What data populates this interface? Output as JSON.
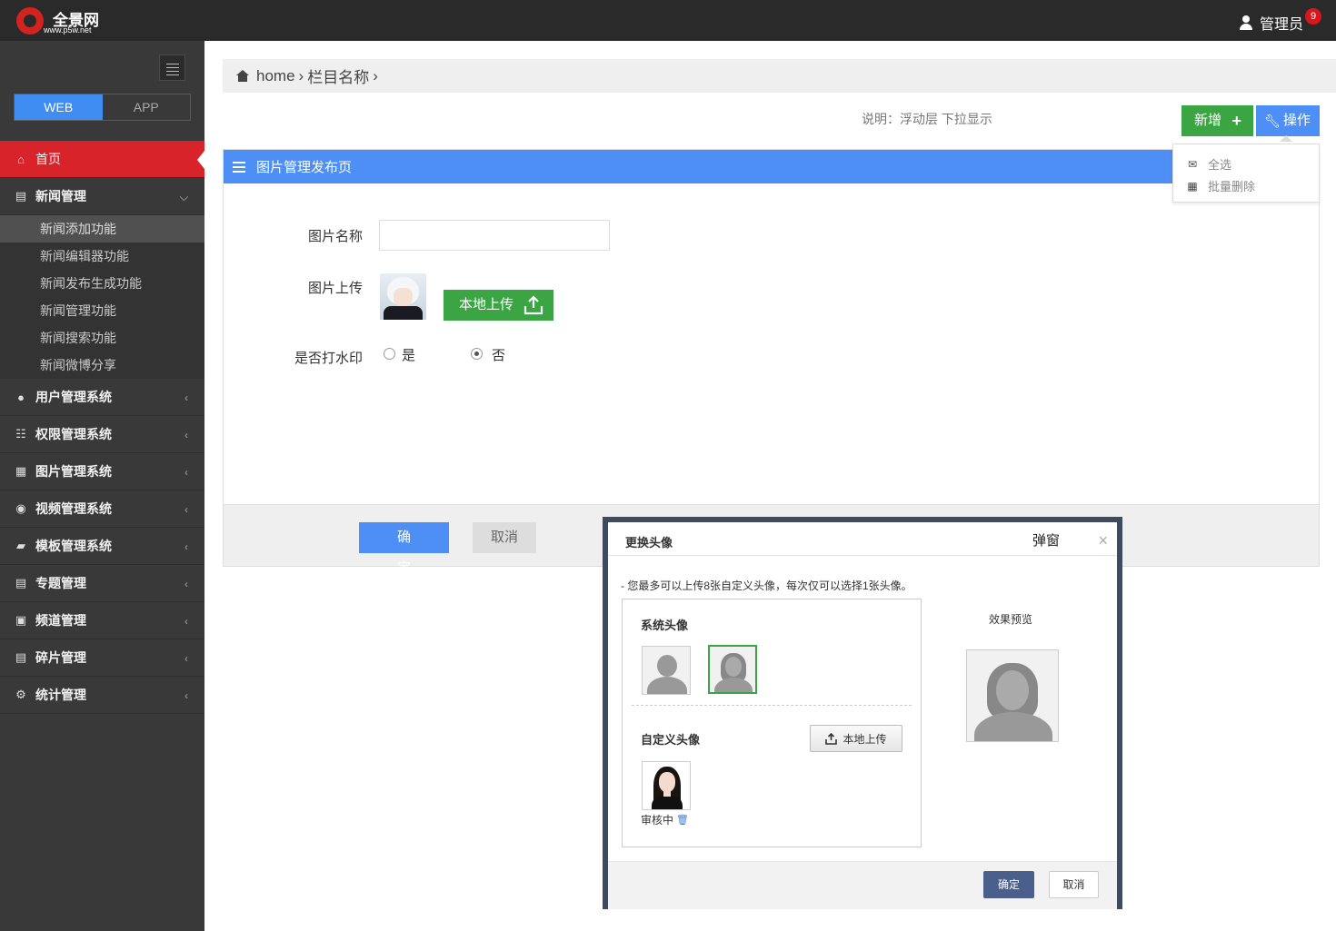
{
  "topbar": {
    "logo_name": "全景网",
    "logo_url": "www.p5w.net",
    "admin_label": "管理员",
    "notification_count": "9"
  },
  "sidebar": {
    "switch": {
      "web": "WEB",
      "app": "APP",
      "active": "WEB"
    },
    "home": "首页",
    "news": {
      "label": "新闻管理",
      "items": [
        "新闻添加功能",
        "新闻编辑器功能",
        "新闻发布生成功能",
        "新闻管理功能",
        "新闻搜索功能",
        "新闻微博分享"
      ],
      "active_item": "新闻添加功能"
    },
    "sections": [
      {
        "label": "用户管理系统",
        "icon": "user-icon"
      },
      {
        "label": "权限管理系统",
        "icon": "sitemap-icon"
      },
      {
        "label": "图片管理系统",
        "icon": "grid-icon"
      },
      {
        "label": "视频管理系统",
        "icon": "map-marker-icon"
      },
      {
        "label": "模板管理系统",
        "icon": "folder-open-icon"
      },
      {
        "label": "专题管理",
        "icon": "file-icon"
      },
      {
        "label": "频道管理",
        "icon": "gift-icon"
      },
      {
        "label": "碎片管理",
        "icon": "file-icon"
      },
      {
        "label": "统计管理",
        "icon": "gears-icon"
      }
    ]
  },
  "breadcrumb": {
    "home": "home",
    "section": "栏目名称"
  },
  "toolbar": {
    "note": "说明：浮动层  下拉显示",
    "add_label": "新增",
    "op_label": "操作",
    "dropdown": [
      "全选",
      "批量删除"
    ]
  },
  "panel": {
    "title": "图片管理发布页",
    "name_label": "图片名称",
    "name_value": "",
    "upload_label": "图片上传",
    "upload_button": "本地上传",
    "watermark_label": "是否打水印",
    "watermark_options": [
      "是",
      "否"
    ],
    "watermark_selected": "否",
    "confirm": "确 定",
    "cancel": "取消"
  },
  "modal": {
    "title": "更换头像",
    "tag": "弹窗",
    "tip": "- 您最多可以上传8张自定义头像，每次仅可以选择1张头像。",
    "system_label": "系统头像",
    "custom_label": "自定义头像",
    "local_upload": "本地上传",
    "review_status": "审核中",
    "preview_label": "效果预览",
    "confirm": "确定",
    "cancel": "取消"
  },
  "colors": {
    "topbar": "#2a2a2a",
    "sidebar": "#393939",
    "active_red": "#d9232a",
    "primary_blue": "#4e8ff5",
    "success_green": "#3aa542",
    "modal_border": "#3d4a5f"
  }
}
